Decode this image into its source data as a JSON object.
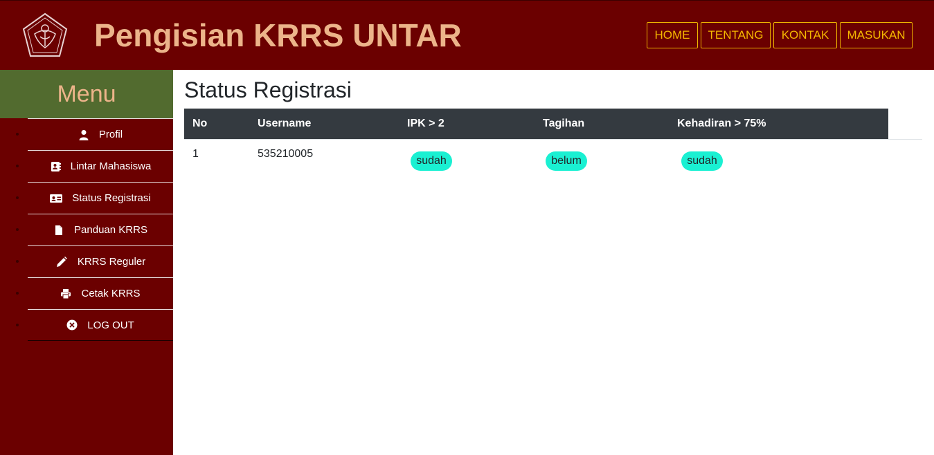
{
  "header": {
    "title": "Pengisian KRRS UNTAR",
    "nav": [
      "HOME",
      "TENTANG",
      "KONTAK",
      "MASUKAN"
    ]
  },
  "sidebar": {
    "heading": "Menu",
    "items": [
      {
        "label": "Profil",
        "icon": "user-icon"
      },
      {
        "label": "Lintar Mahasiswa",
        "icon": "address-book-icon"
      },
      {
        "label": "Status Registrasi",
        "icon": "id-card-icon"
      },
      {
        "label": "Panduan KRRS",
        "icon": "file-icon"
      },
      {
        "label": "KRRS Reguler",
        "icon": "pencil-icon"
      },
      {
        "label": "Cetak KRRS",
        "icon": "printer-icon"
      },
      {
        "label": "LOG OUT",
        "icon": "close-circle-icon"
      }
    ]
  },
  "main": {
    "title": "Status Registrasi",
    "table": {
      "headers": [
        "No",
        "Username",
        "IPK > 2",
        "Tagihan",
        "Kehadiran > 75%"
      ],
      "rows": [
        {
          "no": "1",
          "username": "535210005",
          "ipk": "sudah",
          "tagihan": "belum",
          "kehadiran": "sudah"
        }
      ]
    }
  },
  "colors": {
    "header_bg": "#6b0000",
    "title_text": "#ecb48a",
    "nav_accent": "#f5b800",
    "menu_head_bg": "#526b2f",
    "table_head_bg": "#343a40",
    "status_pill": "#1af0d2"
  }
}
